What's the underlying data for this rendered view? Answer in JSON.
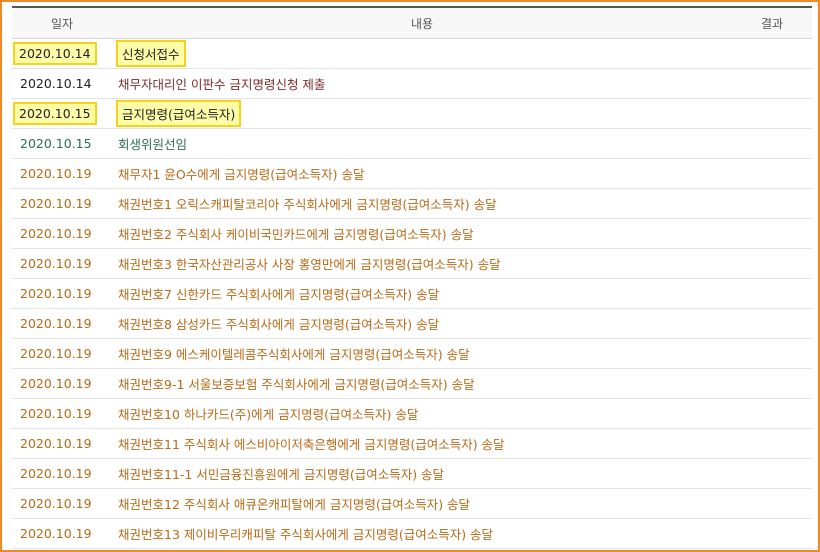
{
  "table": {
    "headers": {
      "date": "일자",
      "content": "내용",
      "result": "결과"
    },
    "rows": [
      {
        "date": "2020.10.14",
        "content": "신청서접수",
        "result": ""
      },
      {
        "date": "2020.10.14",
        "content": "채무자대리인 이판수 금지명령신청 제출",
        "result": ""
      },
      {
        "date": "2020.10.15",
        "content": "금지명령(급여소득자)",
        "result": ""
      },
      {
        "date": "2020.10.15",
        "content": "회생위원선임",
        "result": ""
      },
      {
        "date": "2020.10.19",
        "content": "채무자1 윤O수에게 금지명령(급여소득자) 송달",
        "result": ""
      },
      {
        "date": "2020.10.19",
        "content": "채권번호1 오릭스캐피탈코리아 주식회사에게 금지명령(급여소득자) 송달",
        "result": ""
      },
      {
        "date": "2020.10.19",
        "content": "채권번호2 주식회사 케이비국민카드에게 금지명령(급여소득자) 송달",
        "result": ""
      },
      {
        "date": "2020.10.19",
        "content": "채권번호3 한국자산관리공사 사장 홍영만에게 금지명령(급여소득자) 송달",
        "result": ""
      },
      {
        "date": "2020.10.19",
        "content": "채권번호7 신한카드 주식회사에게 금지명령(급여소득자) 송달",
        "result": ""
      },
      {
        "date": "2020.10.19",
        "content": "채권번호8 삼성카드 주식회사에게 금지명령(급여소득자) 송달",
        "result": ""
      },
      {
        "date": "2020.10.19",
        "content": "채권번호9 에스케이텔레콤주식회사에게 금지명령(급여소득자) 송달",
        "result": ""
      },
      {
        "date": "2020.10.19",
        "content": "채권번호9-1 서울보증보험 주식회사에게 금지명령(급여소득자) 송달",
        "result": ""
      },
      {
        "date": "2020.10.19",
        "content": "채권번호10 하나카드(주)에게 금지명령(급여소득자) 송달",
        "result": ""
      },
      {
        "date": "2020.10.19",
        "content": "채권번호11 주식회사 에스비아이저축은행에게 금지명령(급여소득자) 송달",
        "result": ""
      },
      {
        "date": "2020.10.19",
        "content": "채권번호11-1 서민금융진흥원에게 금지명령(급여소득자) 송달",
        "result": ""
      },
      {
        "date": "2020.10.19",
        "content": "채권번호12 주식회사 애큐온캐피탈에게 금지명령(급여소득자) 송달",
        "result": ""
      },
      {
        "date": "2020.10.19",
        "content": "채권번호13 제이비우리캐피탈 주식회사에게 금지명령(급여소득자) 송달",
        "result": ""
      }
    ]
  },
  "colors": {
    "frame_border": "#f08a24",
    "highlight_fill": "#fdfca8",
    "highlight_border": "#f7d21b",
    "text_black": "#222222",
    "text_teal": "#2d6b5b",
    "text_orange": "#b86a17",
    "text_red": "#7a2c2c"
  }
}
